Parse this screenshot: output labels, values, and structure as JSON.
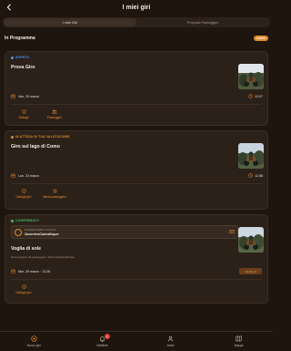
{
  "header": {
    "title": "I miei giri"
  },
  "tabs": [
    {
      "label": "I miei Giri",
      "active": true
    },
    {
      "label": "Proposte Passeggeri",
      "active": false
    }
  ],
  "section": {
    "title": "In Programma",
    "count": "3 attivi"
  },
  "cards": [
    {
      "status": "APERTO",
      "status_color": "#4d8ff0",
      "title": "Prova Giro",
      "date": "Ven, 20 marzo",
      "time": "12:07",
      "actions": [
        {
          "label": "Dettagli"
        },
        {
          "label": "Passeggeri"
        }
      ]
    },
    {
      "status": "IN ATTESA DI TUA VALUTAZIONE",
      "status_color": "#e08a2c",
      "title": "Giro sul lago di Como",
      "date": "Lun, 23 marzo",
      "time": "11:58",
      "actions": [
        {
          "label": "Dettagli giro"
        },
        {
          "label": "Valuta passeggero"
        }
      ]
    },
    {
      "status": "CONFERMATO",
      "status_color": "#3fbf6a",
      "passenger_label": "PASSEGGERO SCELTO",
      "passenger_name": "ZavorrinaCarinaSuper",
      "title": "Voglia di sole",
      "proposer": "Giro proposto da passeggero: ZavorrinaCarinaSuper",
      "date": "Mer, 25 marzo · 13:28",
      "chip": "Tra 5g 1h",
      "actions": [
        {
          "label": "Dettagli giro"
        }
      ]
    }
  ],
  "nav": [
    {
      "label": "Nuovo giro"
    },
    {
      "label": "Notifiche",
      "badge": "1"
    },
    {
      "label": "Amici"
    },
    {
      "label": "Mappa"
    }
  ],
  "colors": {
    "accent": "#e08a2c",
    "background": "#1f150f",
    "card": "#2c2119"
  }
}
